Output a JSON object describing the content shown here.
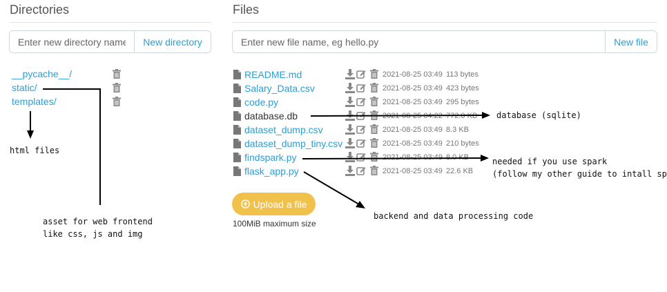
{
  "directories": {
    "title": "Directories",
    "input_placeholder": "Enter new directory name",
    "button_label": "New directory",
    "items": [
      {
        "name": "__pycache__/"
      },
      {
        "name": "static/"
      },
      {
        "name": "templates/"
      }
    ]
  },
  "files": {
    "title": "Files",
    "input_placeholder": "Enter new file name, eg hello.py",
    "button_label": "New file",
    "items": [
      {
        "name": "README.md",
        "date": "2021-08-25 03:49",
        "size": "113 bytes"
      },
      {
        "name": "Salary_Data.csv",
        "date": "2021-08-25 03:49",
        "size": "423 bytes"
      },
      {
        "name": "code.py",
        "date": "2021-08-25 03:49",
        "size": "295 bytes"
      },
      {
        "name": "database.db",
        "date": "2021-08-25 04:22",
        "size": "772.0 KB"
      },
      {
        "name": "dataset_dump.csv",
        "date": "2021-08-25 03:49",
        "size": "8.3 KB"
      },
      {
        "name": "dataset_dump_tiny.csv",
        "date": "2021-08-25 03:49",
        "size": "210 bytes"
      },
      {
        "name": "findspark.py",
        "date": "2021-08-25 03:49",
        "size": "8.0 KB"
      },
      {
        "name": "flask_app.py",
        "date": "2021-08-25 03:49",
        "size": "22.6 KB"
      }
    ]
  },
  "upload": {
    "button_label": "Upload a file",
    "note": "100MiB maximum size"
  },
  "annotations": {
    "html_files": "html files",
    "asset_note_line1": "asset for web frontend",
    "asset_note_line2": "like css, js and img",
    "database_note": "database (sqlite)",
    "spark_note_line1": "needed if you use spark",
    "spark_note_line2": "(follow my other guide to intall spark)",
    "backend_note": "backend and data processing code"
  },
  "colors": {
    "link": "#2a9fd6",
    "upload_button": "#f0c14b",
    "icon_gray": "#888888"
  }
}
